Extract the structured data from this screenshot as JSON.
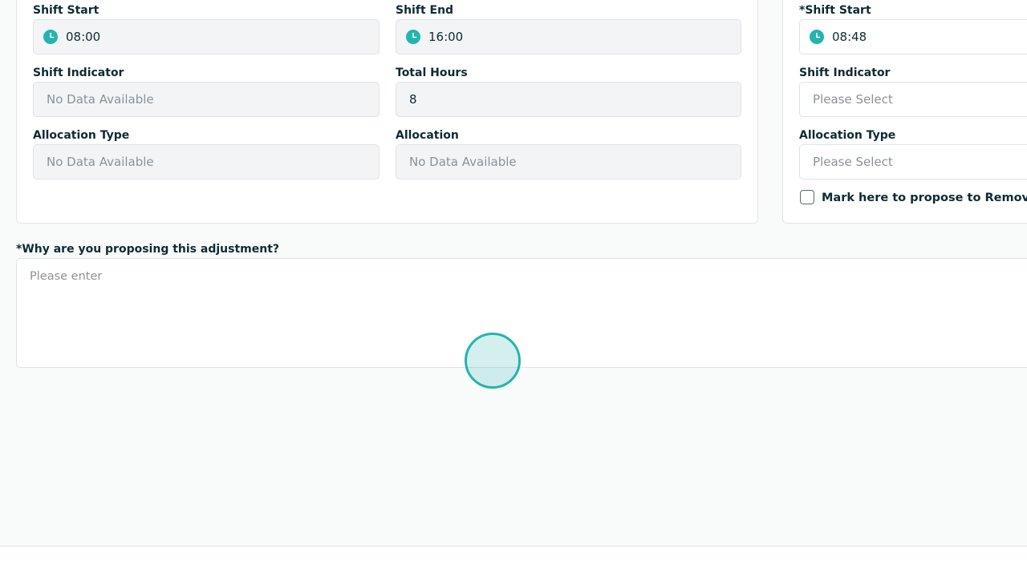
{
  "current_shift": {
    "shift_start": {
      "label": "Shift Start",
      "value": "08:00",
      "icon": "clock-icon"
    },
    "shift_end": {
      "label": "Shift End",
      "value": "16:00",
      "icon": "clock-icon"
    },
    "shift_indicator": {
      "label": "Shift Indicator",
      "value": "No Data Available"
    },
    "total_hours": {
      "label": "Total Hours",
      "value": "8"
    },
    "allocation_type": {
      "label": "Allocation Type",
      "value": "No Data Available"
    },
    "allocation": {
      "label": "Allocation",
      "value": "No Data Available"
    }
  },
  "proposed_shift": {
    "shift_start": {
      "label": "*Shift Start",
      "value": "08:48",
      "icon": "clock-icon"
    },
    "shift_indicator": {
      "label": "Shift Indicator",
      "placeholder": "Please Select"
    },
    "allocation_type": {
      "label": "Allocation Type",
      "placeholder": "Please Select"
    },
    "remove_checkbox": {
      "label": "Mark here to propose to Remove t",
      "checked": false
    }
  },
  "reason": {
    "label": "*Why are you proposing this adjustment?",
    "placeholder": "Please enter"
  },
  "colors": {
    "accent": "#23b5ad",
    "text": "#0f2a33",
    "placeholder": "#8a9399",
    "input_bg": "#f3f4f6",
    "border": "#dfe3e6"
  }
}
